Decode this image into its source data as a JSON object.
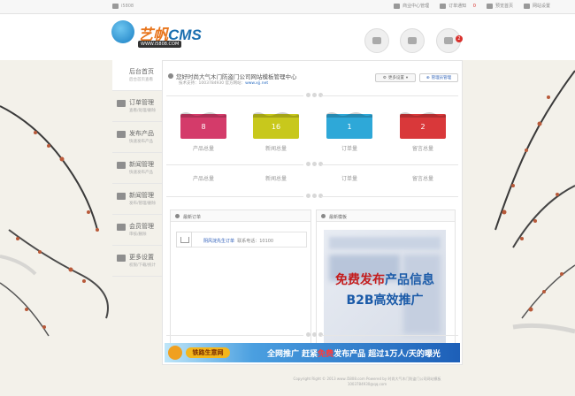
{
  "topbar": {
    "site": "i5808",
    "links": [
      "商业中心管理",
      "订单通知",
      "预览首页",
      "网站设置"
    ],
    "order_count": "0"
  },
  "header": {
    "logo_text_a": "艺帆",
    "logo_text_b": "CMS",
    "logo_url": "WWW.i5808.COM",
    "badge": "2"
  },
  "sidebar": {
    "items": [
      {
        "title": "后台首页",
        "sub": "后台首页查看"
      },
      {
        "title": "订单管理",
        "sub": "查看/处理/删除"
      },
      {
        "title": "发布产品",
        "sub": "快速发布产品"
      },
      {
        "title": "新闻管理",
        "sub": "快速发布产品"
      },
      {
        "title": "新闻管理",
        "sub": "发布/管理/删除"
      },
      {
        "title": "会员管理",
        "sub": "审核/删除"
      },
      {
        "title": "更多设置",
        "sub": "权限/下载/统计"
      }
    ]
  },
  "main": {
    "welcome": "您好时尚大气木门防盗门公司网站模板管理中心",
    "tech_support": "技术支持：1003784930  官方网站：",
    "website": "www.xjj.net",
    "btn_more": "更多设置",
    "btn_admin": "管理员管理",
    "stats": [
      {
        "value": "8",
        "label": "产品总量",
        "color": "#d43b6a"
      },
      {
        "value": "16",
        "label": "新闻总量",
        "color": "#c8c81c"
      },
      {
        "value": "1",
        "label": "订单量",
        "color": "#2ea8d8"
      },
      {
        "value": "2",
        "label": "留言总量",
        "color": "#d9383a"
      }
    ],
    "stat_labels_row2": [
      "产品总量",
      "新闻总量",
      "订单量",
      "留言总量"
    ],
    "orders_panel": {
      "title": "最新订单",
      "order_name": "阴风淀先生订单",
      "order_phone": "联系电话：10100"
    },
    "templates_panel": {
      "title": "最新模板",
      "ad_line1_a": "免费发布",
      "ad_line1_b": "产品信息",
      "ad_line2": "B2B高效推广"
    }
  },
  "banner": {
    "logo": "铁路生意网",
    "text_a": "全网推广  赶紧",
    "text_red": "免费",
    "text_b": "发布产品  超过1万人/天的曝光"
  },
  "footer": {
    "line1": "Copyright Right © 2013 www.i5808.com Powered by 时尚大气木门防盗门公司网站模板",
    "line2": "1003784930@qq.com"
  }
}
